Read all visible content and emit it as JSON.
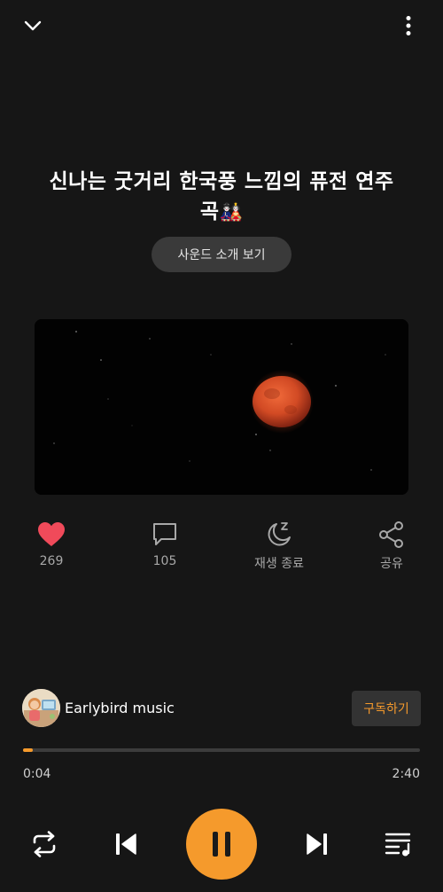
{
  "header": {
    "collapse_icon": "chevron-down-icon",
    "more_icon": "more-vertical-icon"
  },
  "track": {
    "title": "신나는 굿거리 한국풍 느낌의 퓨전 연주",
    "title_line2": "곡",
    "title_emoji": "🎎",
    "intro_button": "사운드 소개 보기"
  },
  "actions": {
    "like_count": "269",
    "comment_count": "105",
    "sleep_timer_label": "재생 종료",
    "share_label": "공유"
  },
  "channel": {
    "name": "Earlybird music",
    "subscribe_label": "구독하기"
  },
  "playback": {
    "current_time": "0:04",
    "total_time": "2:40",
    "progress_fraction": 0.025
  },
  "colors": {
    "accent": "#f59a2c",
    "like": "#f04a5a",
    "background": "#161616",
    "moon": "#d9502a"
  },
  "controls": {
    "repeat_icon": "repeat-icon",
    "previous_icon": "skip-previous-icon",
    "pause_icon": "pause-icon",
    "next_icon": "skip-next-icon",
    "playlist_icon": "playlist-icon"
  }
}
